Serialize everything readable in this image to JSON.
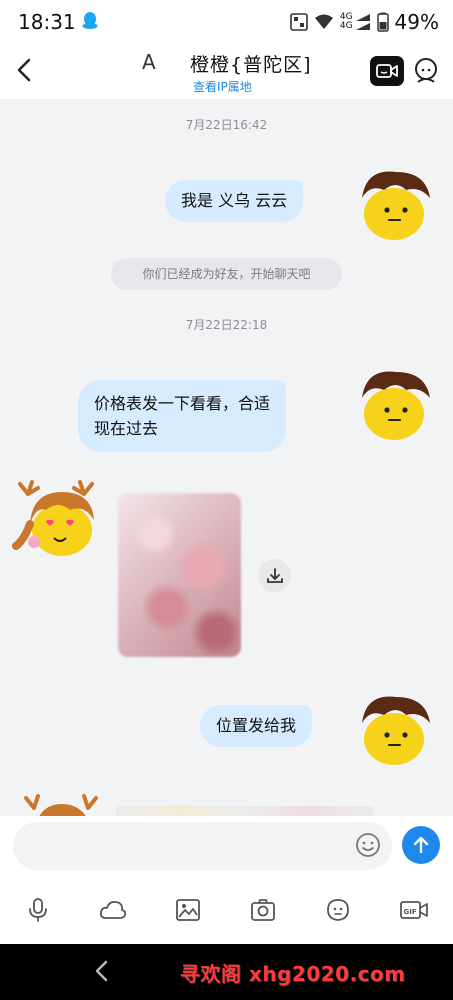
{
  "status_bar": {
    "time": "18:31",
    "signal_label_top": "4G",
    "signal_label_bottom": "4G",
    "battery": "49%"
  },
  "header": {
    "letter": "A",
    "title": "橙橙{普陀区]",
    "subtitle": "查看IP属地"
  },
  "messages": {
    "ts1": "7月22日16:42",
    "m1": "我是 义乌  云云",
    "system": "你们已经成为好友，开始聊天吧",
    "ts2": "7月22日22:18",
    "m2_line1": "价格表发一下看看，合适",
    "m2_line2": "现在过去",
    "m3": "位置发给我"
  },
  "watermark": "寻欢阁 xhg2020.com",
  "colors": {
    "accent_blue": "#1e88ec",
    "bubble_out": "#d6ebfd",
    "chat_bg": "#f2f3f5",
    "watermark_red": "#ff3b3b"
  }
}
